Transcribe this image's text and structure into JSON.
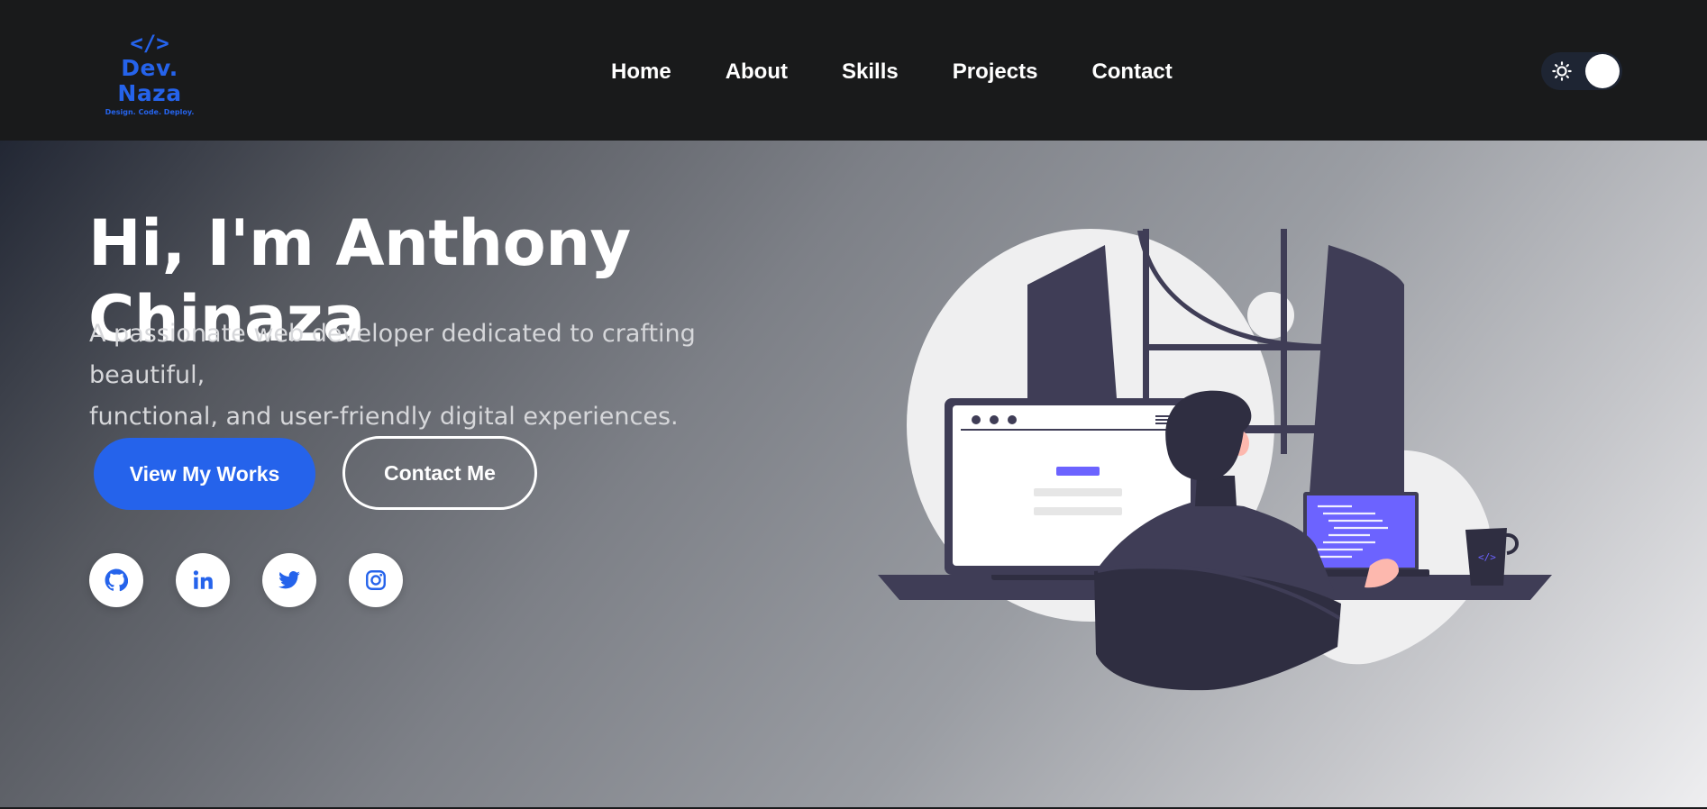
{
  "brand": {
    "symbol": "</>",
    "name": "Dev. Naza",
    "tagline": "Design. Code. Deploy.",
    "color": "#2563eb"
  },
  "nav": {
    "items": [
      {
        "label": "Home"
      },
      {
        "label": "About"
      },
      {
        "label": "Skills"
      },
      {
        "label": "Projects"
      },
      {
        "label": "Contact"
      }
    ]
  },
  "theme_toggle": {
    "icon": "sun-icon",
    "state": "light"
  },
  "hero": {
    "title": "Hi, I'm Anthony Chinaza",
    "subtitle_line1": "A passionate web developer dedicated to crafting beautiful,",
    "subtitle_line2": "functional, and user-friendly digital experiences.",
    "primary_button": "View My Works",
    "secondary_button": "Contact Me",
    "socials": [
      {
        "icon": "github-icon"
      },
      {
        "icon": "linkedin-icon"
      },
      {
        "icon": "twitter-icon"
      },
      {
        "icon": "instagram-icon"
      }
    ],
    "illustration_mug_label": "</>"
  },
  "colors": {
    "accent": "#2563eb",
    "navbar_bg": "#191a1b",
    "laptop_screen": "#6c63ff",
    "illustration_dark": "#3f3d56"
  }
}
